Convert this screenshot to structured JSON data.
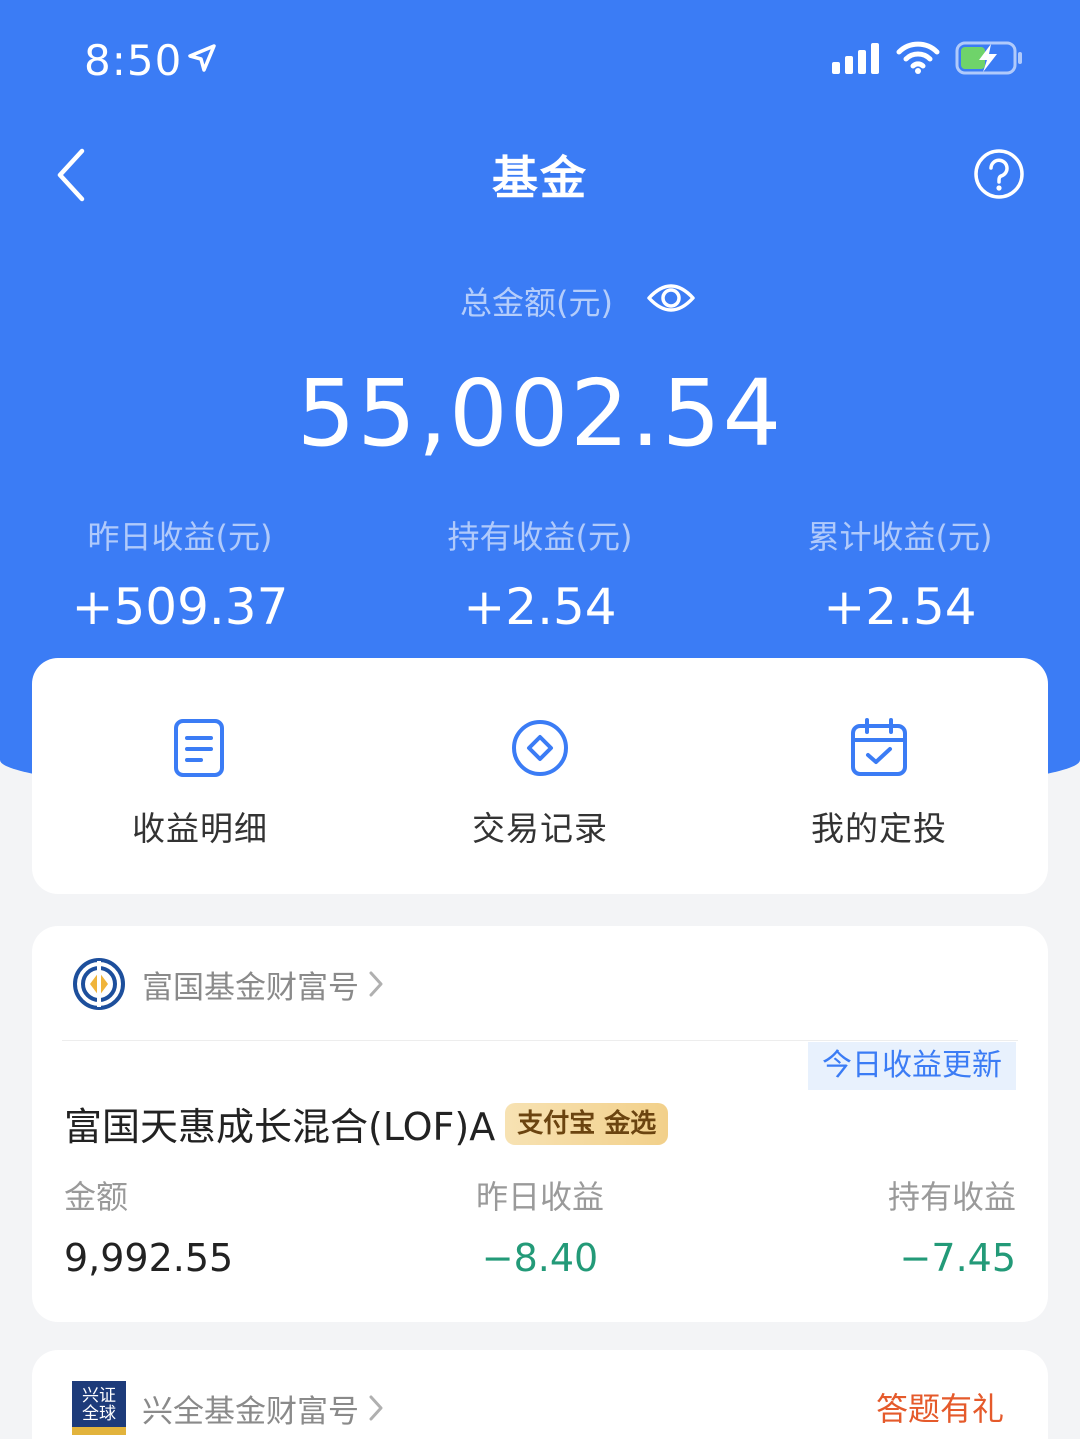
{
  "status_bar": {
    "time": "8:50"
  },
  "nav": {
    "title": "基金"
  },
  "summary": {
    "total_label": "总金额(元)",
    "total_amount": "55,002.54",
    "stats": [
      {
        "label": "昨日收益(元)",
        "value": "+509.37"
      },
      {
        "label": "持有收益(元)",
        "value": "+2.54"
      },
      {
        "label": "累计收益(元)",
        "value": "+2.54"
      }
    ]
  },
  "actions": [
    {
      "label": "收益明细",
      "icon": "document-icon"
    },
    {
      "label": "交易记录",
      "icon": "diamond-circle-icon"
    },
    {
      "label": "我的定投",
      "icon": "calendar-check-icon"
    }
  ],
  "funds": [
    {
      "provider": "富国基金财富号",
      "badge": "今日收益更新",
      "name": "富国天惠成长混合(LOF)A",
      "tag": "支付宝 金选",
      "columns": [
        {
          "label": "金额",
          "value": "9,992.55"
        },
        {
          "label": "昨日收益",
          "value": "−8.40"
        },
        {
          "label": "持有收益",
          "value": "−7.45"
        }
      ]
    },
    {
      "provider": "兴全基金财富号",
      "logo_text": "兴证全球",
      "promo": "答题有礼"
    }
  ],
  "colors": {
    "primary": "#3b7cf5",
    "negative": "#239a78",
    "promo": "#e55a2b"
  }
}
